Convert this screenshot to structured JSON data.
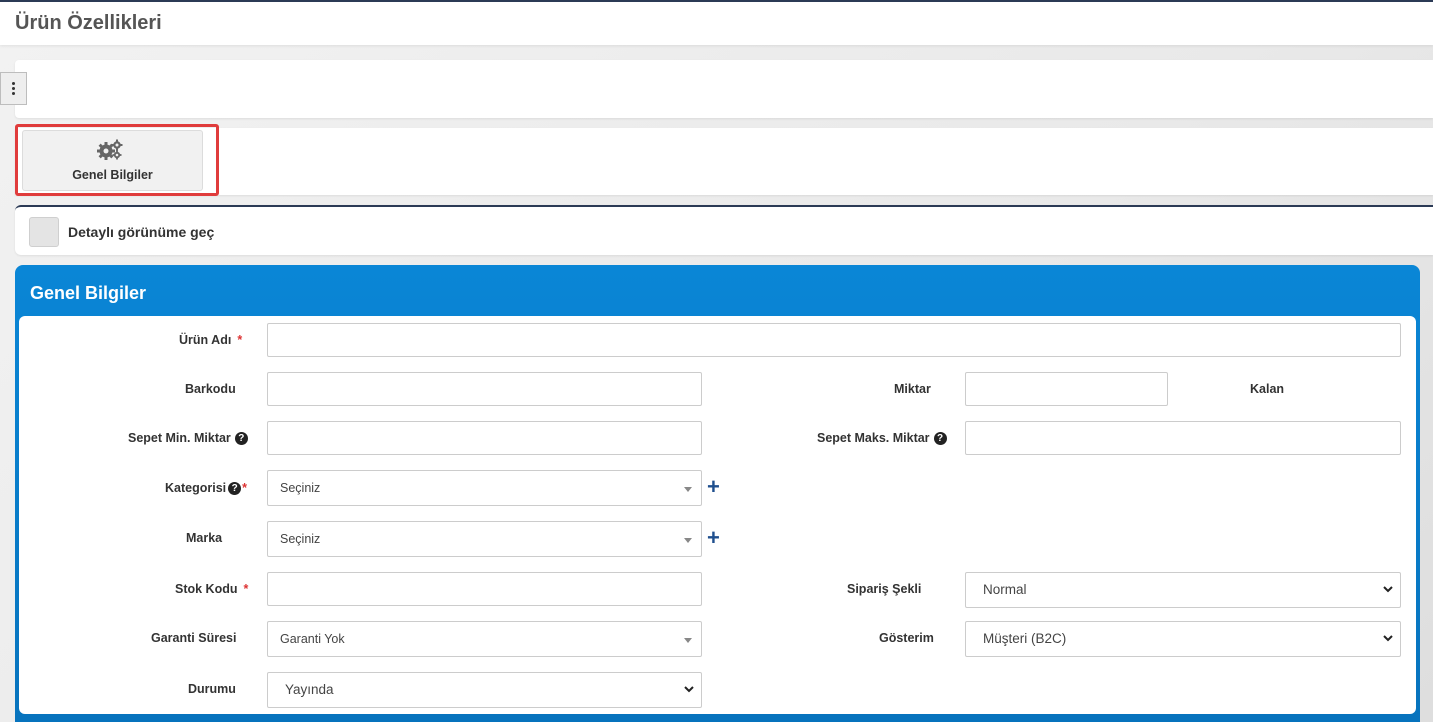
{
  "page": {
    "title": "Ürün Özellikleri"
  },
  "tabs": {
    "genel_label": "Genel Bilgiler"
  },
  "detail_toggle": {
    "label": "Detaylı görünüme geç",
    "checked": false
  },
  "section": {
    "title": "Genel Bilgiler"
  },
  "form": {
    "urun_adi": {
      "label": "Ürün Adı",
      "required": "*",
      "value": ""
    },
    "barkodu": {
      "label": "Barkodu",
      "value": ""
    },
    "miktar": {
      "label": "Miktar",
      "value": ""
    },
    "kalan": {
      "label": "Kalan"
    },
    "sepet_min": {
      "label": "Sepet Min. Miktar",
      "help": "?",
      "value": ""
    },
    "sepet_maks": {
      "label": "Sepet Maks. Miktar",
      "help": "?",
      "value": ""
    },
    "kategori": {
      "label": "Kategorisi",
      "help": "?",
      "required": "*",
      "selected": "Seçiniz",
      "add": "+"
    },
    "marka": {
      "label": "Marka",
      "selected": "Seçiniz",
      "add": "+"
    },
    "stok_kodu": {
      "label": "Stok Kodu",
      "required": "*",
      "value": ""
    },
    "siparis_sekli": {
      "label": "Sipariş Şekli",
      "selected": "Normal"
    },
    "garanti_suresi": {
      "label": "Garanti Süresi",
      "selected": "Garanti Yok"
    },
    "gosterim": {
      "label": "Gösterim",
      "selected": "Müşteri (B2C)"
    },
    "durumu": {
      "label": "Durumu",
      "selected": "Yayında"
    }
  },
  "colors": {
    "accent": "#0a86d6",
    "highlight": "#e03c3c",
    "plus": "#1f4f8e",
    "required": "#d33333"
  }
}
